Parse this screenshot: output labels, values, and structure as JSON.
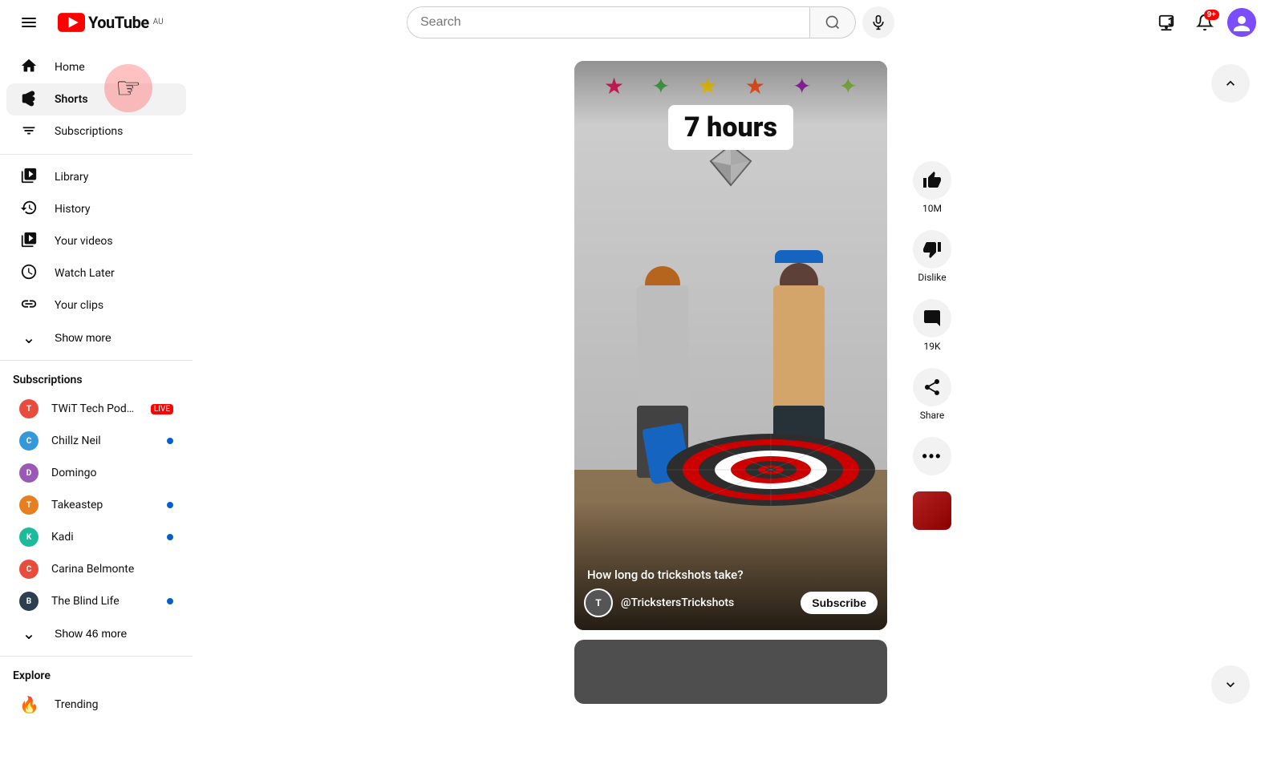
{
  "header": {
    "hamburger_label": "☰",
    "logo_text": "YouTube",
    "logo_country": "AU",
    "search_placeholder": "Search",
    "search_icon": "🔍",
    "mic_icon": "🎤",
    "create_icon": "+",
    "notif_icon": "🔔",
    "notif_count": "9+",
    "avatar_initial": ""
  },
  "sidebar": {
    "nav_items": [
      {
        "id": "home",
        "label": "Home",
        "icon": "⌂",
        "active": false
      },
      {
        "id": "shorts",
        "label": "Shorts",
        "icon": "▶",
        "active": true
      },
      {
        "id": "subscriptions",
        "label": "Subscriptions",
        "icon": "▦",
        "active": false
      },
      {
        "id": "library",
        "label": "Library",
        "icon": "□",
        "active": false
      },
      {
        "id": "history",
        "label": "History",
        "icon": "↺",
        "active": false
      },
      {
        "id": "your-videos",
        "label": "Your videos",
        "icon": "▷",
        "active": false
      },
      {
        "id": "watch-later",
        "label": "Watch Later",
        "icon": "⏱",
        "active": false
      },
      {
        "id": "your-clips",
        "label": "Your clips",
        "icon": "✂",
        "active": false
      }
    ],
    "show_more_label": "Show more",
    "subscriptions_title": "Subscriptions",
    "subscriptions": [
      {
        "id": "twit",
        "name": "TWiT Tech Podc...",
        "has_dot": false,
        "live": true,
        "color": "#e74c3c"
      },
      {
        "id": "chillzneil",
        "name": "Chillz Neil",
        "has_dot": true,
        "live": false,
        "color": "#3498db"
      },
      {
        "id": "domingo",
        "name": "Domingo",
        "has_dot": false,
        "live": false,
        "color": "#9b59b6"
      },
      {
        "id": "takeastep",
        "name": "Takeastep",
        "has_dot": true,
        "live": false,
        "color": "#e67e22"
      },
      {
        "id": "kadi",
        "name": "Kadi",
        "has_dot": true,
        "live": false,
        "color": "#1abc9c"
      },
      {
        "id": "carina",
        "name": "Carina Belmonte",
        "has_dot": false,
        "live": false,
        "color": "#e74c3c"
      },
      {
        "id": "blindlife",
        "name": "The Blind Life",
        "has_dot": true,
        "live": false,
        "color": "#2c3e50"
      }
    ],
    "show_more_subs_label": "Show 46 more",
    "explore_title": "Explore",
    "explore_items": [
      {
        "id": "trending",
        "label": "Trending",
        "icon": "🔥"
      }
    ]
  },
  "short": {
    "hours_badge": "7 hours",
    "title": "How long do trickshots take?",
    "channel_name": "@TrickstersTrickshots",
    "subscribe_label": "Subscribe",
    "like_count": "10M",
    "comment_count": "19K",
    "share_label": "Share",
    "dislike_label": "Dislike",
    "more_label": "...",
    "stars_decoration": "★ ✦ ★ ✧"
  },
  "scroll": {
    "up_icon": "↑",
    "down_icon": "↓"
  }
}
